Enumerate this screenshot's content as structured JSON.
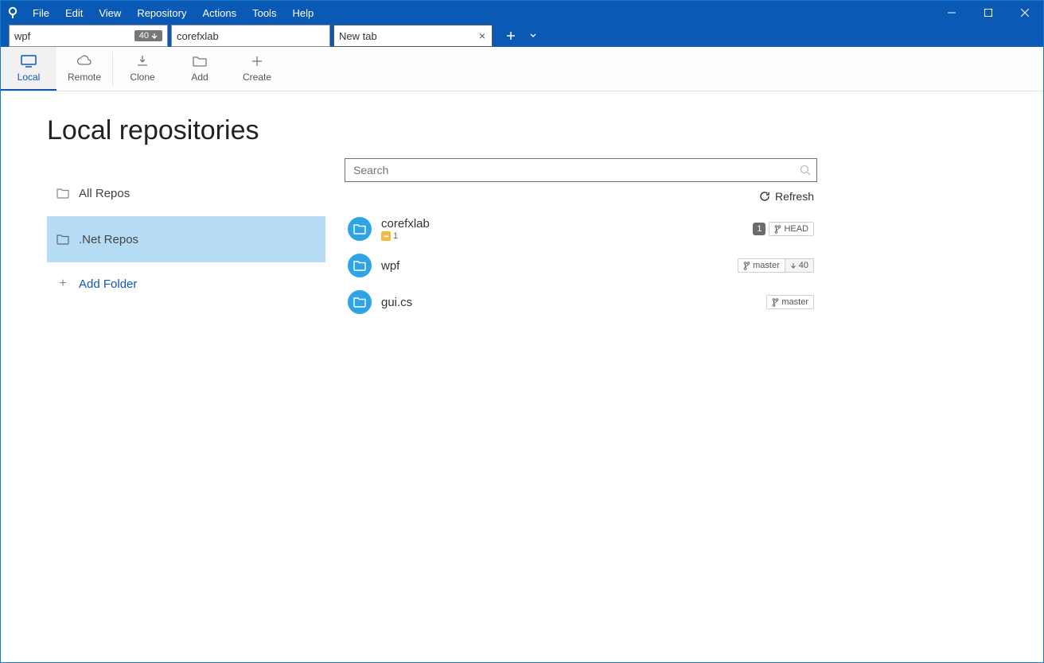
{
  "menu": {
    "file": "File",
    "edit": "Edit",
    "view": "View",
    "repository": "Repository",
    "actions": "Actions",
    "tools": "Tools",
    "help": "Help"
  },
  "tabs": [
    {
      "label": "wpf",
      "badge": "40",
      "active": false,
      "closeable": false,
      "has_badge": true
    },
    {
      "label": "corefxlab",
      "badge": "",
      "active": false,
      "closeable": false,
      "has_badge": false
    },
    {
      "label": "New tab",
      "badge": "",
      "active": true,
      "closeable": true,
      "has_badge": false
    }
  ],
  "toolbar": {
    "local": "Local",
    "remote": "Remote",
    "clone": "Clone",
    "add": "Add",
    "create": "Create"
  },
  "page": {
    "title": "Local repositories"
  },
  "sidebar": {
    "items": [
      {
        "label": "All Repos",
        "selected": false
      },
      {
        "label": ".Net Repos",
        "selected": true
      }
    ],
    "add_folder": "Add Folder"
  },
  "search": {
    "placeholder": "Search",
    "value": ""
  },
  "refresh": "Refresh",
  "repos": [
    {
      "name": "corefxlab",
      "stash_count": "1",
      "change_count": "1",
      "branch": "HEAD",
      "behind": ""
    },
    {
      "name": "wpf",
      "stash_count": "",
      "change_count": "",
      "branch": "master",
      "behind": "40"
    },
    {
      "name": "gui.cs",
      "stash_count": "",
      "change_count": "",
      "branch": "master",
      "behind": ""
    }
  ]
}
